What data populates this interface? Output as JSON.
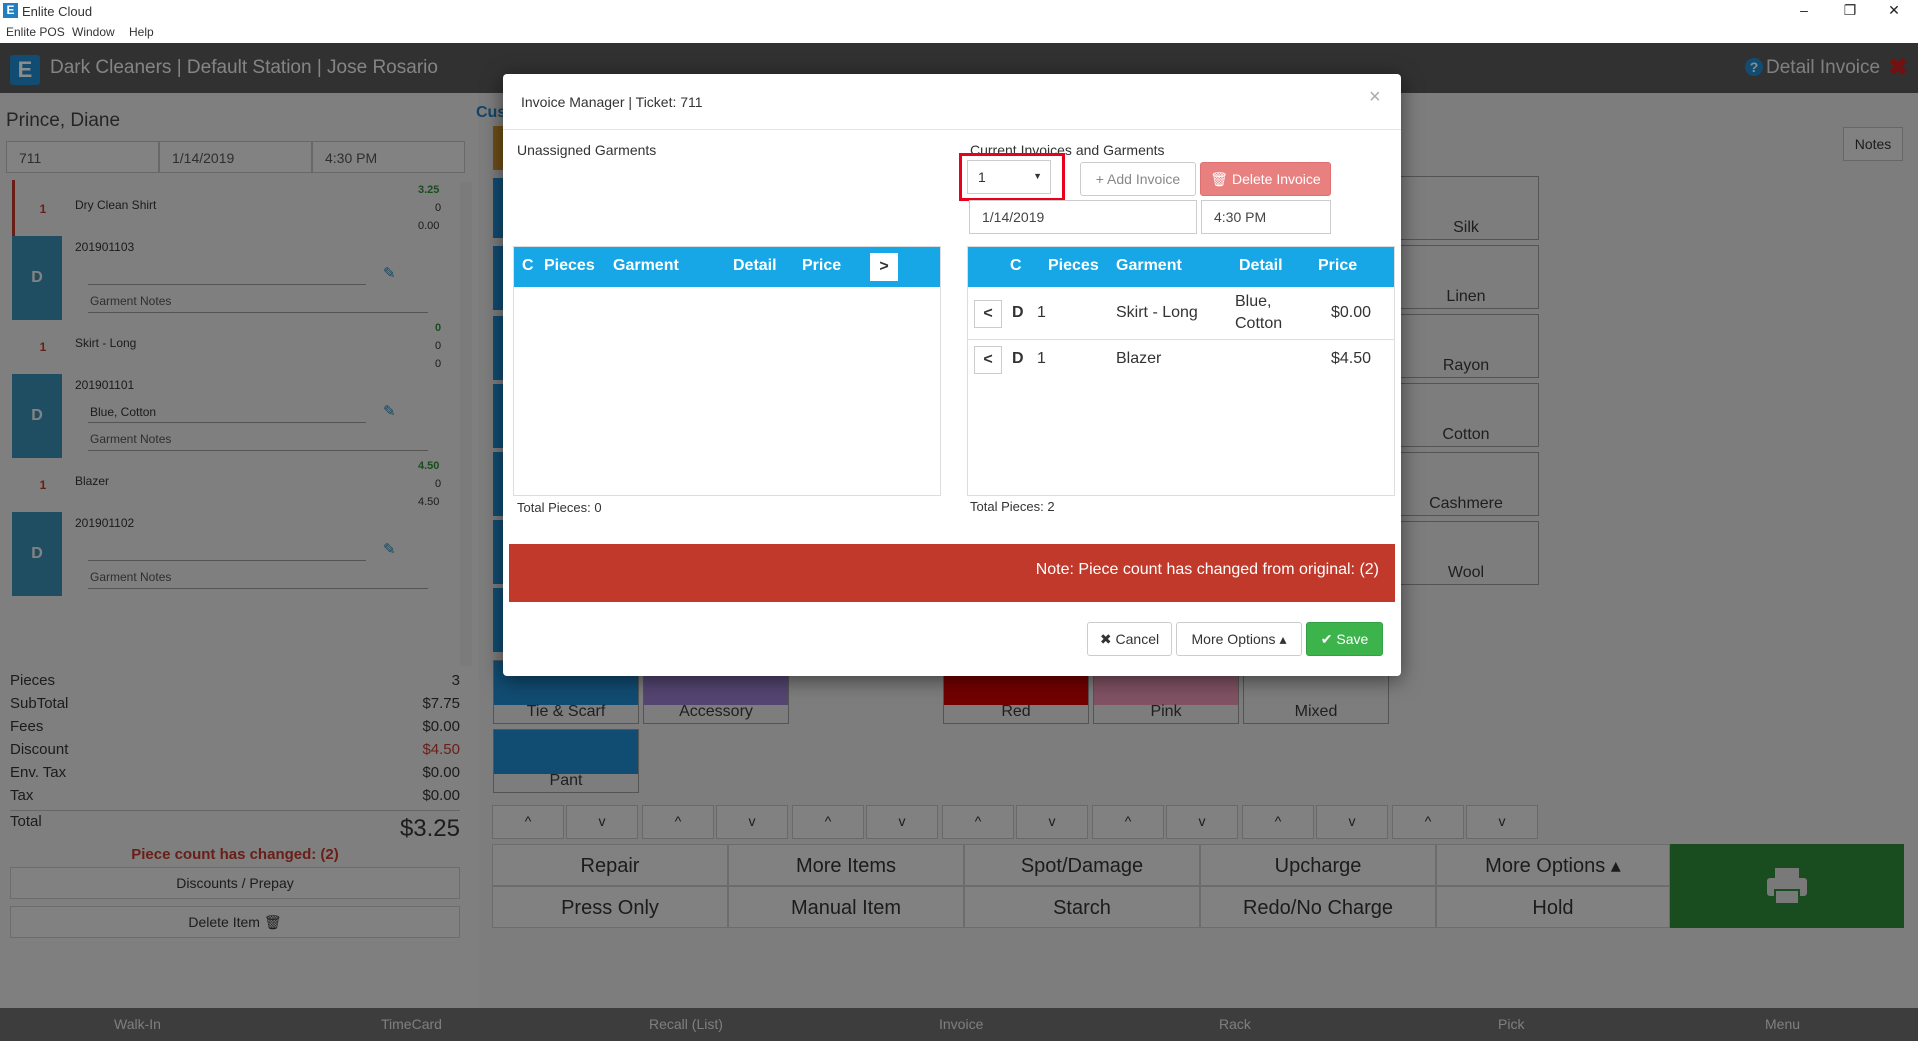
{
  "window": {
    "title": "Enlite Cloud",
    "minimize": "–",
    "restore": "❐",
    "close": "✕",
    "logo": "E"
  },
  "menu": [
    "Enlite POS",
    "Window",
    "Help"
  ],
  "header": {
    "logo": "E",
    "title": "Dark Cleaners | Default Station | Jose Rosario",
    "right_label": "Detail Invoice",
    "help": "?",
    "close": "✖"
  },
  "customer": {
    "name": "Prince, Diane",
    "ticket": "711",
    "date": "1/14/2019",
    "time": "4:30 PM"
  },
  "garments": [
    {
      "qty": "1",
      "name": "Dry Clean Shirt",
      "code": "201901103",
      "type": "D",
      "detail": "",
      "notes": "Garment Notes",
      "n1": "3.25",
      "n2": "0",
      "n3": "0.00"
    },
    {
      "qty": "1",
      "name": "Skirt - Long",
      "code": "201901101",
      "type": "D",
      "detail": "Blue, Cotton",
      "notes": "Garment Notes",
      "n1": "0",
      "n2": "0",
      "n3": "0"
    },
    {
      "qty": "1",
      "name": "Blazer",
      "code": "201901102",
      "type": "D",
      "detail": "",
      "notes": "Garment Notes",
      "n1": "4.50",
      "n2": "0",
      "n3": "4.50"
    }
  ],
  "summary": {
    "pieces_label": "Pieces",
    "pieces": "3",
    "subtotal_label": "SubTotal",
    "subtotal": "$7.75",
    "fees_label": "Fees",
    "fees": "$0.00",
    "discount_label": "Discount",
    "discount": "$4.50",
    "envtax_label": "Env. Tax",
    "envtax": "$0.00",
    "tax_label": "Tax",
    "tax": "$0.00",
    "total_label": "Total",
    "total": "$3.25",
    "warning": "Piece count has changed: (2)",
    "discounts_btn": "Discounts / Prepay",
    "delete_btn": "Delete Item 🗑"
  },
  "side_tab": "Cus",
  "notes_btn": "Notes",
  "fabrics": [
    "Silk",
    "Linen",
    "Rayon",
    "Cotton",
    "Cashmere",
    "Wool"
  ],
  "tiles_row": [
    "Tie & Scarf",
    "Accessory",
    "Red",
    "Pink",
    "Mixed"
  ],
  "tile_pant": "Pant",
  "arrow_up": "^",
  "arrow_down": "v",
  "actions_row1": [
    "Repair",
    "More Items",
    "Spot/Damage",
    "Upcharge",
    "More Options ▴"
  ],
  "actions_row2": [
    "Press Only",
    "Manual Item",
    "Starch",
    "Redo/No Charge",
    "Hold"
  ],
  "footer": [
    "Walk-In",
    "TimeCard",
    "Recall (List)",
    "Invoice",
    "Rack",
    "Pick",
    "Menu"
  ],
  "modal": {
    "title": "Invoice Manager | Ticket: 711",
    "close": "×",
    "unassigned_label": "Unassigned Garments",
    "current_label": "Current Invoices and Garments",
    "invoice_select": "1",
    "add_invoice": "+ Add Invoice",
    "delete_invoice": "🗑 Delete Invoice",
    "date": "1/14/2019",
    "time": "4:30 PM",
    "left_headers": [
      "C",
      "Pieces",
      "Garment",
      "Detail",
      "Price"
    ],
    "right_headers": [
      "C",
      "Pieces",
      "Garment",
      "Detail",
      "Price"
    ],
    "move_btn": ">",
    "back_btn": "<",
    "rows": [
      {
        "c": "D",
        "pieces": "1",
        "garment": "Skirt - Long",
        "detail1": "Blue,",
        "detail2": "Cotton",
        "price": "$0.00"
      },
      {
        "c": "D",
        "pieces": "1",
        "garment": "Blazer",
        "detail1": "",
        "detail2": "",
        "price": "$4.50"
      }
    ],
    "left_total": "Total Pieces: 0",
    "right_total": "Total Pieces: 2",
    "note": "Note: Piece count has changed from original: (2)",
    "cancel": "✖ Cancel",
    "more_options": "More Options ▴",
    "save": "✔ Save"
  },
  "colors": {
    "accent": "#17a6e6",
    "note_bg": "#c0392b",
    "save": "#3cb44b",
    "delete": "#e88080",
    "highlight": "#e8001c"
  }
}
